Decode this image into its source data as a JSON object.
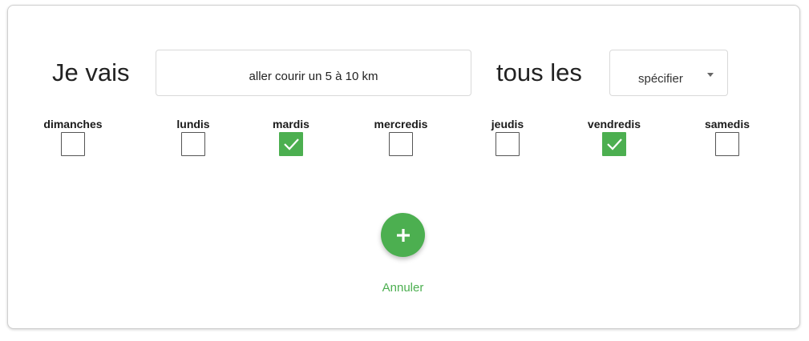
{
  "form": {
    "prefix_text": "Je vais",
    "activity_value": "aller courir un 5 à 10 km",
    "middle_text": "tous les",
    "frequency_select": {
      "value": "spécifier",
      "icon": "caret-down-icon"
    }
  },
  "days": [
    {
      "label": "dimanches",
      "checked": false
    },
    {
      "label": "lundis",
      "checked": false
    },
    {
      "label": "mardis",
      "checked": true
    },
    {
      "label": "mercredis",
      "checked": false
    },
    {
      "label": "jeudis",
      "checked": false
    },
    {
      "label": "vendredis",
      "checked": true
    },
    {
      "label": "samedis",
      "checked": false
    }
  ],
  "actions": {
    "add_icon": "plus-icon",
    "cancel_label": "Annuler"
  },
  "colors": {
    "accent": "#4caf50",
    "text": "#222222",
    "border": "#d9d9d9"
  }
}
